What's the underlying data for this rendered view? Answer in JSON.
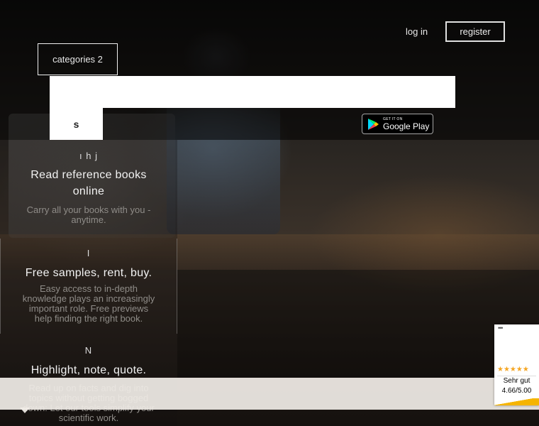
{
  "header": {
    "login_label": "log in",
    "register_label": "register",
    "categories_label": "categories 2"
  },
  "search": {
    "value": "",
    "button_label": "s"
  },
  "app_store": {
    "small_label": "GET IT ON",
    "big_label": "Google Play"
  },
  "features": [
    {
      "icon_glyph": "ı h j",
      "title": "Read reference books online",
      "description": "Carry all your books with you - anytime."
    },
    {
      "icon_glyph": "I",
      "title": "Free samples, rent, buy.",
      "description": "Easy access to in-depth knowledge plays an increasingly important role. Free previews help finding the right book."
    },
    {
      "icon_glyph": "N",
      "title": "Highlight, note, quote.",
      "description": "Read up on facts and dig into topics without getting bogged down: Let our tools simplify your scientific work."
    }
  ],
  "rating_badge": {
    "menu_dots": "•••",
    "stars": "★★★★★",
    "label": "Sehr gut",
    "score": "4.66/5.00"
  },
  "colors": {
    "accent_star": "#f5a623",
    "ribbon": "#f5b400"
  }
}
